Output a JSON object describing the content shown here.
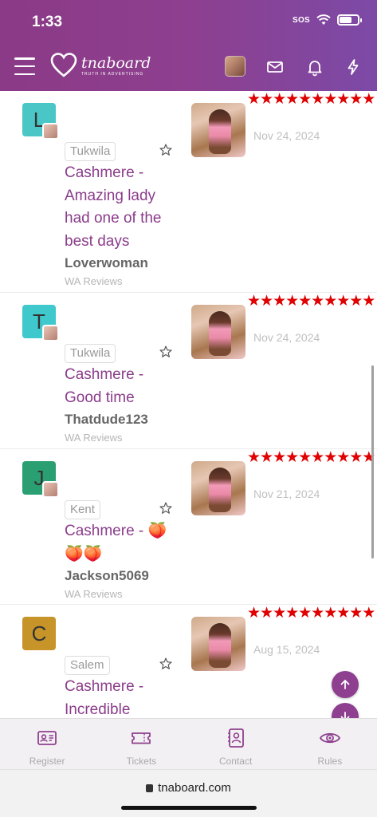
{
  "status_bar": {
    "time": "1:33",
    "sos": "SOS",
    "battery_level": 0.7
  },
  "header": {
    "logo_name": "tnaboard",
    "logo_tagline": "TRUTH IN ADVERTISING"
  },
  "reviews": [
    {
      "avatar_letter": "L",
      "avatar_color": "#4ac6c6",
      "city": "Tukwila",
      "title": "Cashmere - Amazing lady had one of the best days",
      "author": "Loverwoman",
      "forum": "WA Reviews",
      "date": "Nov 24, 2024",
      "rating": 10
    },
    {
      "avatar_letter": "T",
      "avatar_color": "#3fc9cc",
      "city": "Tukwila",
      "title": "Cashmere - Good time",
      "author": "Thatdude123",
      "forum": "WA Reviews",
      "date": "Nov 24, 2024",
      "rating": 10
    },
    {
      "avatar_letter": "J",
      "avatar_color": "#2aa072",
      "city": "Kent",
      "title": "Cashmere - 🍑🍑🍑",
      "author": "Jackson5069",
      "forum": "WA Reviews",
      "date": "Nov 21, 2024",
      "rating": 10
    },
    {
      "avatar_letter": "C",
      "avatar_color": "#c7942a",
      "city": "Salem",
      "title": "Cashmere - Incredible",
      "author": "",
      "forum": "",
      "date": "Aug 15, 2024",
      "rating": 10
    }
  ],
  "bottom_nav": [
    {
      "label": "Register",
      "icon": "id-card-icon"
    },
    {
      "label": "Tickets",
      "icon": "ticket-icon"
    },
    {
      "label": "Contact",
      "icon": "contact-book-icon"
    },
    {
      "label": "Rules",
      "icon": "eye-icon"
    }
  ],
  "browser": {
    "url": "tnaboard.com"
  },
  "colors": {
    "brand": "#8e3f8f",
    "star": "#e00000"
  }
}
